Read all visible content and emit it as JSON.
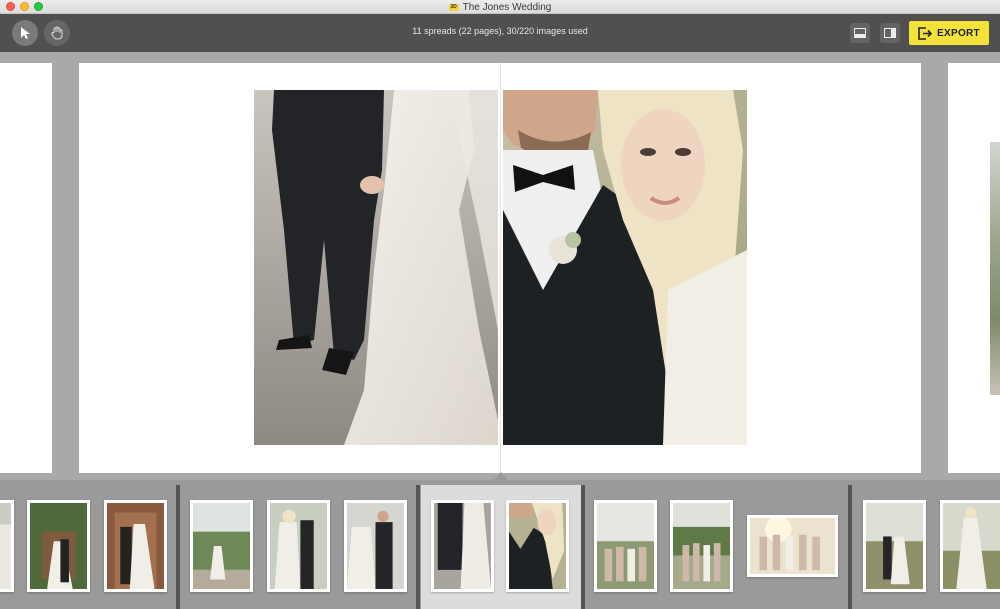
{
  "window": {
    "title": "The Jones Wedding",
    "app_icon_label": "3D"
  },
  "toolbar": {
    "status": "11 spreads (22 pages), 30/220 images used",
    "export_label": "EXPORT",
    "tools": [
      "arrow-pointer-icon",
      "hand-icon"
    ],
    "views": [
      "bottom-panel-icon",
      "side-panel-icon"
    ]
  },
  "colors": {
    "accent": "#f2e23a",
    "toolbar": "#505050",
    "canvas": "#a9a9a9",
    "selected_group": "#dcdcdc"
  },
  "spread": {
    "left_photo": "couple holding hands",
    "right_photo": "bride resting head on groom"
  }
}
